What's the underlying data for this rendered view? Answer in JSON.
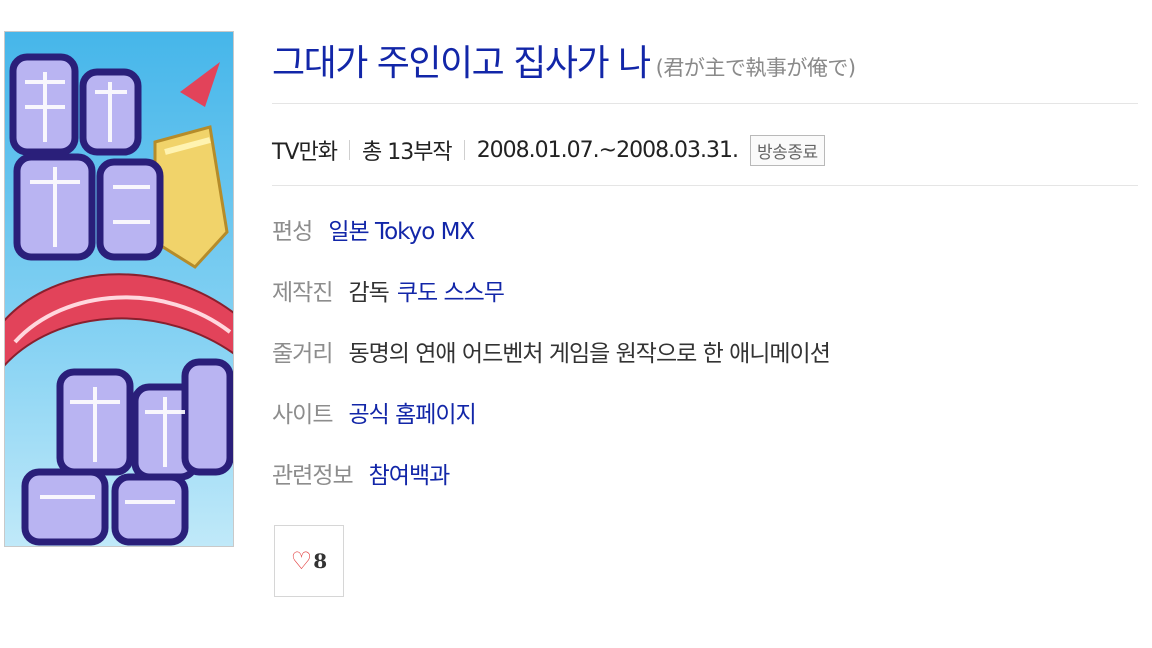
{
  "poster": {
    "icon": "anime-poster-image",
    "colors": {
      "sky": "#5fc3ef",
      "text_fill": "#b9b4f2",
      "text_outline": "#2a1f7a",
      "ribbon": "#e2435a"
    }
  },
  "title": {
    "main": "그대가 주인이고 집사가 나",
    "original": "(君が主で執事が俺で)"
  },
  "meta": {
    "type": "TV만화",
    "episodes": "총 13부작",
    "period": "2008.01.07.~2008.03.31.",
    "status": "방송종료"
  },
  "details": {
    "network": {
      "label": "편성",
      "value": "일본 Tokyo MX"
    },
    "staff": {
      "label": "제작진",
      "role": "감독",
      "value": "쿠도 스스무"
    },
    "synopsis": {
      "label": "줄거리",
      "value": "동명의 연애 어드벤처 게임을 원작으로 한 애니메이션"
    },
    "site": {
      "label": "사이트",
      "value": "공식 홈페이지"
    },
    "related": {
      "label": "관련정보",
      "value": "참여백과"
    }
  },
  "like": {
    "icon": "heart-icon",
    "symbol": "♡",
    "count": "8"
  },
  "colors": {
    "link": "#1226a8",
    "label": "#8d8d8d",
    "divider": "#e5e5e5"
  }
}
